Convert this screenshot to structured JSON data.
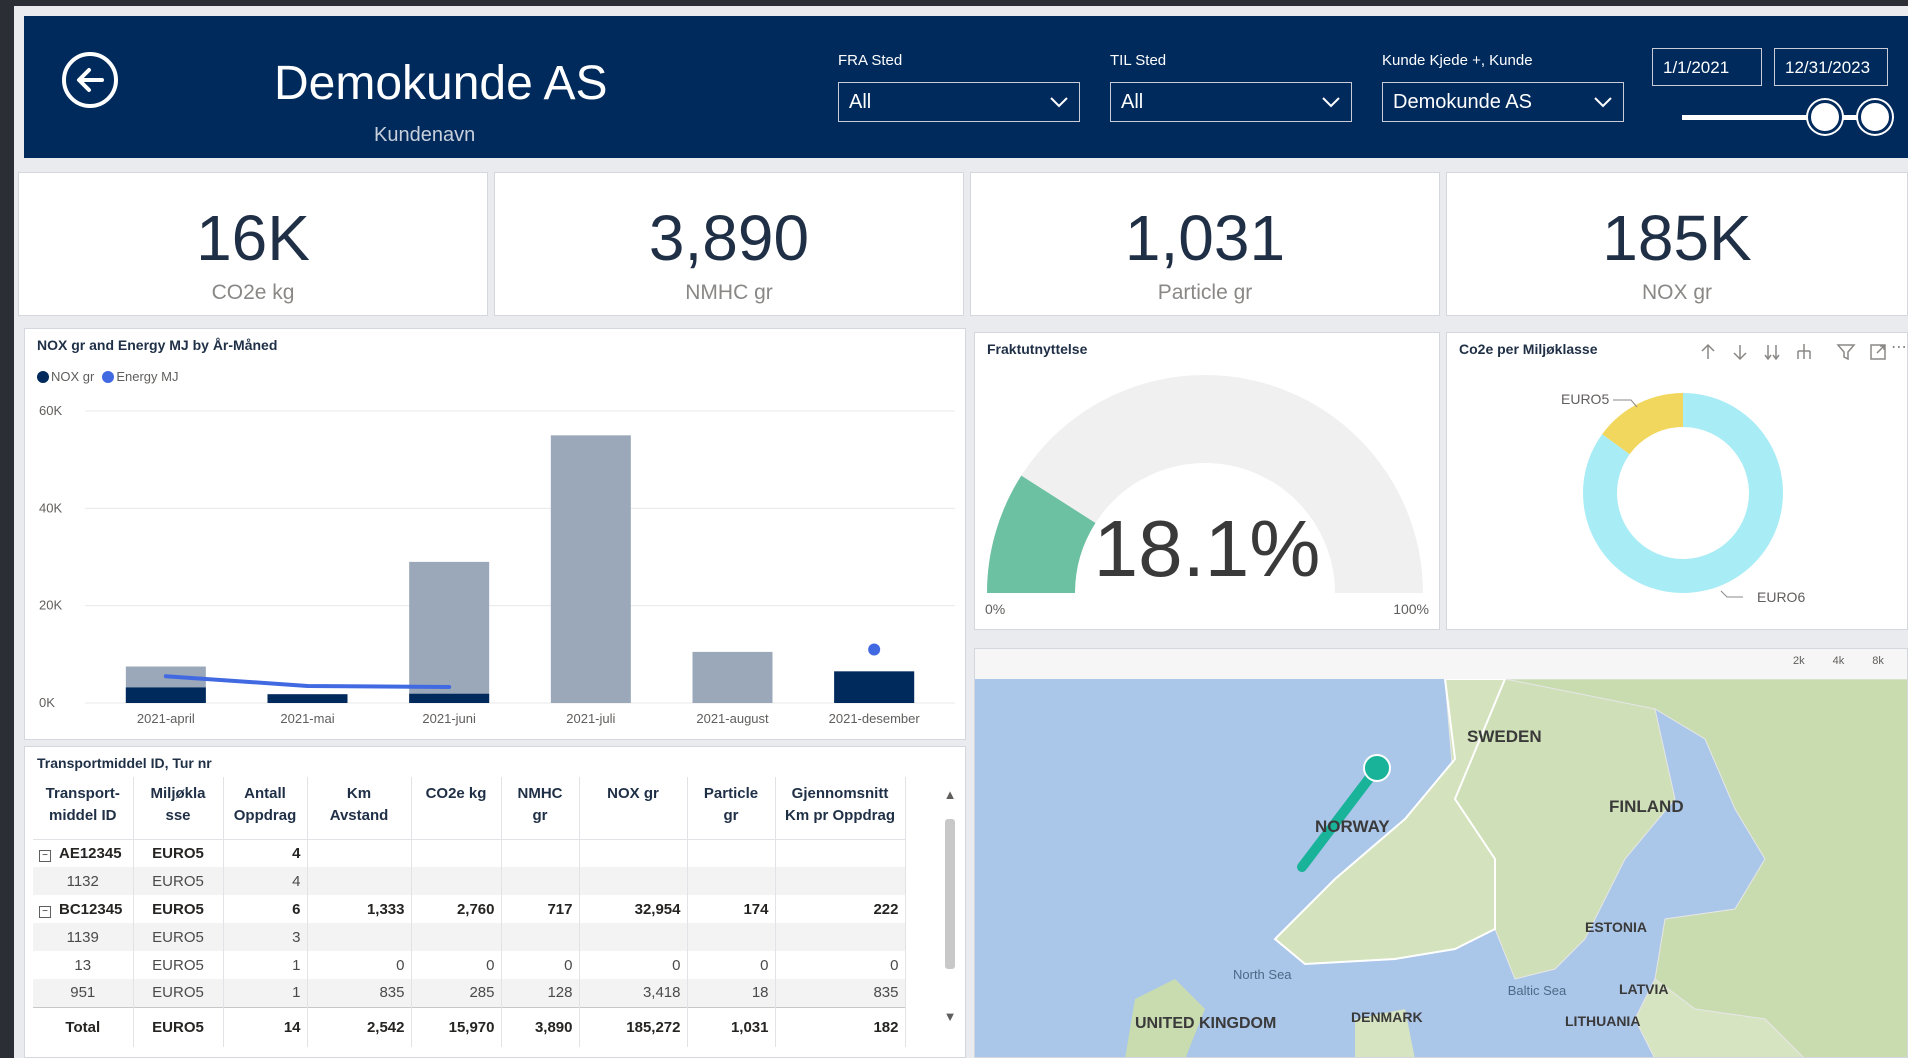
{
  "header": {
    "customer_name": "Demokunde AS",
    "customer_label": "Kundenavn",
    "slicers": [
      {
        "label": "FRA Sted",
        "value": "All"
      },
      {
        "label": "TIL Sted",
        "value": "All"
      },
      {
        "label": "Kunde Kjede +, Kunde",
        "value": "Demokunde AS"
      }
    ],
    "date_start": "1/1/2021",
    "date_end": "12/31/2023"
  },
  "kpis": [
    {
      "value": "16K",
      "label": "CO2e kg"
    },
    {
      "value": "3,890",
      "label": "NMHC gr"
    },
    {
      "value": "1,031",
      "label": "Particle gr"
    },
    {
      "value": "185K",
      "label": "NOX gr"
    }
  ],
  "combo_chart": {
    "title": "NOX gr and Energy MJ by År-Måned",
    "legend": [
      "NOX gr",
      "Energy MJ"
    ]
  },
  "gauge": {
    "title": "Fraktutnyttelse",
    "value_label": "18.1%",
    "min_label": "0%",
    "max_label": "100%"
  },
  "donut": {
    "title": "Co2e per Miljøklasse",
    "labels": [
      "EURO5",
      "EURO6"
    ]
  },
  "table": {
    "title": "Transportmiddel ID, Tur nr",
    "headers": [
      [
        "Transport-",
        "middel ID"
      ],
      [
        "Miljøkla",
        "sse"
      ],
      [
        "Antall",
        "Oppdrag"
      ],
      [
        "Km",
        "Avstand"
      ],
      [
        "CO2e kg",
        ""
      ],
      [
        "NMHC",
        "gr"
      ],
      [
        "NOX gr",
        ""
      ],
      [
        "Particle",
        "gr"
      ],
      [
        "Gjennomsnitt",
        "Km pr Oppdrag"
      ]
    ],
    "rows": [
      {
        "type": "parent",
        "cells": [
          "AE12345",
          "EURO5",
          "4",
          "",
          "",
          "",
          "",
          "",
          ""
        ]
      },
      {
        "type": "child",
        "cells": [
          "1132",
          "EURO5",
          "4",
          "",
          "",
          "",
          "",
          "",
          ""
        ]
      },
      {
        "type": "parent",
        "cells": [
          "BC12345",
          "EURO5",
          "6",
          "1,333",
          "2,760",
          "717",
          "32,954",
          "174",
          "222"
        ]
      },
      {
        "type": "child",
        "cells": [
          "1139",
          "EURO5",
          "3",
          "",
          "",
          "",
          "",
          "",
          ""
        ]
      },
      {
        "type": "child",
        "cells": [
          "13",
          "EURO5",
          "1",
          "0",
          "0",
          "0",
          "0",
          "0",
          "0"
        ]
      },
      {
        "type": "child",
        "cells": [
          "951",
          "EURO5",
          "1",
          "835",
          "285",
          "128",
          "3,418",
          "18",
          "835"
        ]
      }
    ],
    "total": [
      "Total",
      "EURO5",
      "14",
      "2,542",
      "15,970",
      "3,890",
      "185,272",
      "1,031",
      "182"
    ]
  },
  "map": {
    "labels": [
      "SWEDEN",
      "FINLAND",
      "NORWAY",
      "ESTONIA",
      "LATVIA",
      "LITHUANIA",
      "DENMARK",
      "UNITED KINGDOM",
      "North Sea",
      "Baltic Sea"
    ],
    "scale": [
      "2k",
      "4k",
      "8k"
    ]
  },
  "chart_data": [
    {
      "type": "bar",
      "title": "NOX gr and Energy MJ by År-Måned",
      "categories": [
        "2021-april",
        "2021-mai",
        "2021-juni",
        "2021-juli",
        "2021-august",
        "2021-desember"
      ],
      "series": [
        {
          "name": "NOX gr",
          "type": "bar",
          "values": [
            3200,
            1800,
            1900,
            0,
            0,
            6500
          ],
          "color": "#002a5c"
        },
        {
          "name": "Energy MJ",
          "type": "line",
          "values": [
            5500,
            3500,
            3300,
            null,
            null,
            11000
          ],
          "color": "#4169e1"
        },
        {
          "name": "",
          "type": "bar",
          "values": [
            7500,
            1800,
            29000,
            55000,
            10500,
            6500
          ],
          "color": "#9aa8b9"
        }
      ],
      "yticks": [
        "0K",
        "20K",
        "40K",
        "60K"
      ],
      "ylim": [
        0,
        60000
      ],
      "legend_position": "top-left"
    },
    {
      "type": "pie",
      "title": "Co2e per Miljøklasse",
      "categories": [
        "EURO5",
        "EURO6"
      ],
      "values": [
        15,
        85
      ],
      "colors": [
        "#f2d75e",
        "#a8ecf6"
      ]
    }
  ]
}
